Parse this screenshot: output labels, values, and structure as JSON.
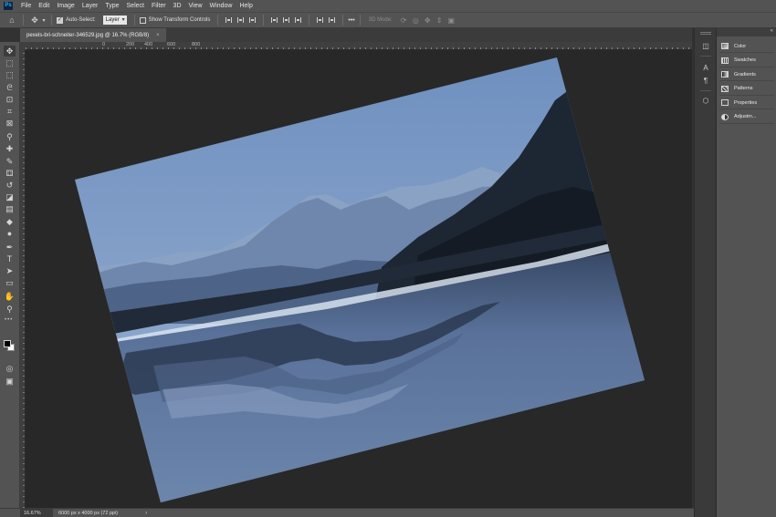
{
  "app": {
    "logo_text": "Ps"
  },
  "menu": [
    "File",
    "Edit",
    "Image",
    "Layer",
    "Type",
    "Select",
    "Filter",
    "3D",
    "View",
    "Window",
    "Help"
  ],
  "options_bar": {
    "auto_select_label": "Auto-Select:",
    "auto_select_checked": true,
    "auto_select_target": "Layer",
    "transform_controls_label": "Show Transform Controls",
    "transform_controls_checked": false,
    "mode_3d_label": "3D Mode:",
    "more_glyph": "•••"
  },
  "document": {
    "tab_title": "pexels-bri-schneiter-346529.jpg @ 16.7% (RGB/8)",
    "close_glyph": "×"
  },
  "ruler": {
    "labels": [
      "0",
      "200",
      "400",
      "600",
      "800"
    ]
  },
  "tools": [
    {
      "name": "move-tool",
      "glyph": "✥"
    },
    {
      "name": "artboard-tool",
      "glyph": "⬚"
    },
    {
      "name": "marquee-tool",
      "glyph": "⬚"
    },
    {
      "name": "lasso-tool",
      "glyph": "ᘓ"
    },
    {
      "name": "object-select-tool",
      "glyph": "⊡"
    },
    {
      "name": "crop-tool",
      "glyph": "⌗"
    },
    {
      "name": "frame-tool",
      "glyph": "⊠"
    },
    {
      "name": "eyedropper-tool",
      "glyph": "⚲"
    },
    {
      "name": "healing-brush-tool",
      "glyph": "✚"
    },
    {
      "name": "brush-tool",
      "glyph": "✎"
    },
    {
      "name": "clone-stamp-tool",
      "glyph": "⚃"
    },
    {
      "name": "history-brush-tool",
      "glyph": "↺"
    },
    {
      "name": "eraser-tool",
      "glyph": "◪"
    },
    {
      "name": "gradient-tool",
      "glyph": "▤"
    },
    {
      "name": "blur-tool",
      "glyph": "◆"
    },
    {
      "name": "dodge-tool",
      "glyph": "●"
    },
    {
      "name": "pen-tool",
      "glyph": "✒"
    },
    {
      "name": "type-tool",
      "glyph": "T"
    },
    {
      "name": "path-selection-tool",
      "glyph": "➤"
    },
    {
      "name": "rectangle-tool",
      "glyph": "▭"
    },
    {
      "name": "hand-tool",
      "glyph": "✋"
    },
    {
      "name": "zoom-tool",
      "glyph": "⚲"
    }
  ],
  "toolbar_more_glyph": "•••",
  "toolbar_bottom": [
    {
      "name": "edit-quick-mask",
      "glyph": "◎"
    },
    {
      "name": "screen-mode",
      "glyph": "▣"
    }
  ],
  "status": {
    "zoom": "16.67%",
    "doc_info": "6000 px x 4000 px (72 ppi)",
    "arrow": "›"
  },
  "right_strip_icons": [
    {
      "name": "history-icon",
      "glyph": "◫"
    },
    {
      "name": "character-icon",
      "glyph": "A"
    },
    {
      "name": "paragraph-icon",
      "glyph": "¶"
    },
    {
      "name": "3d-cube-icon",
      "glyph": "⬡"
    }
  ],
  "panels": [
    {
      "label": "Color",
      "icon": "color"
    },
    {
      "label": "Swatches",
      "icon": "swatches"
    },
    {
      "label": "Gradients",
      "icon": "gradients"
    },
    {
      "label": "Patterns",
      "icon": "patterns"
    },
    {
      "label": "Properties",
      "icon": "props"
    },
    {
      "label": "Adjustm...",
      "icon": "adjust"
    }
  ],
  "colors": {
    "chrome": "#535353",
    "pasteboard": "#282828",
    "sky_top": "#6e8fbf",
    "sky_bottom": "#9bb2d2",
    "water": "#6c86ac",
    "foreground_swatch": "#000000",
    "background_swatch": "#ffffff"
  }
}
